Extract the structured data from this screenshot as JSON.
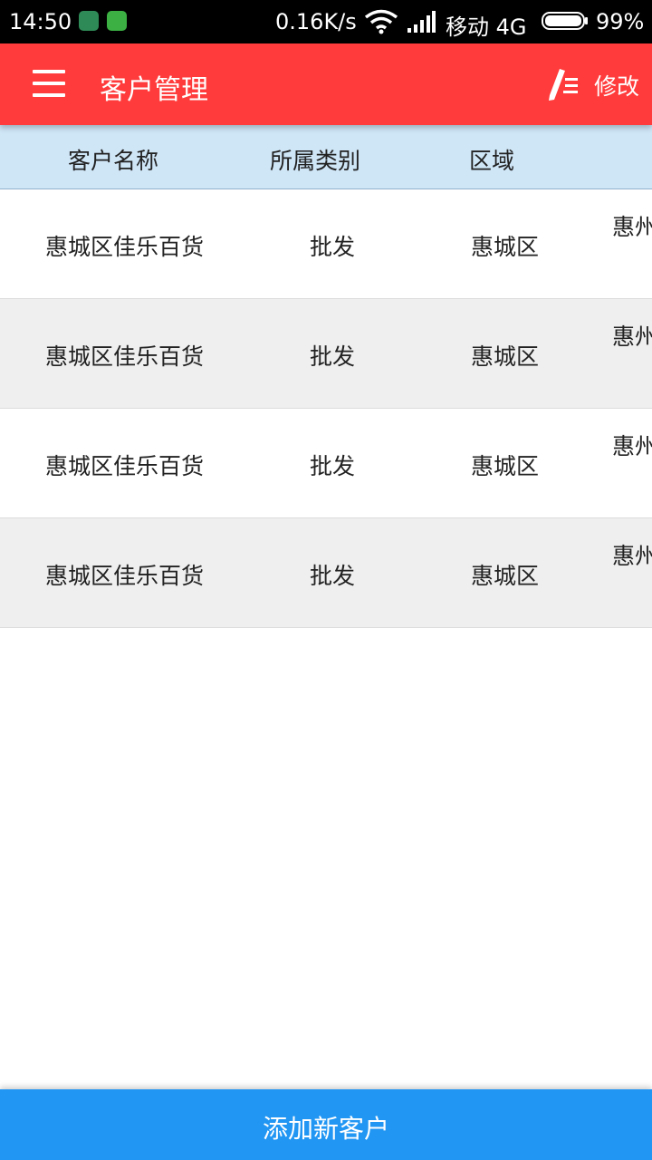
{
  "status_bar": {
    "time": "14:50",
    "speed": "0.16K/s",
    "carrier": "移动 4G",
    "battery": "99%",
    "icons": [
      "shield-icon",
      "message-icon",
      "wifi-icon",
      "signal-icon",
      "battery-icon"
    ]
  },
  "toolbar": {
    "title": "客户管理",
    "edit_label": "修改",
    "color": "#ff3b3b"
  },
  "table": {
    "headers": [
      "客户名称",
      "所属类别",
      "区域"
    ],
    "header_bg": "#cfe6f7",
    "rows": [
      {
        "name": "惠城区佳乐百货",
        "category": "批发",
        "region": "惠城区",
        "address": "惠州"
      },
      {
        "name": "惠城区佳乐百货",
        "category": "批发",
        "region": "惠城区",
        "address": "惠州"
      },
      {
        "name": "惠城区佳乐百货",
        "category": "批发",
        "region": "惠城区",
        "address": "惠州"
      },
      {
        "name": "惠城区佳乐百货",
        "category": "批发",
        "region": "惠城区",
        "address": "惠州"
      }
    ]
  },
  "footer": {
    "add_label": "添加新客户",
    "color": "#2196f3"
  }
}
